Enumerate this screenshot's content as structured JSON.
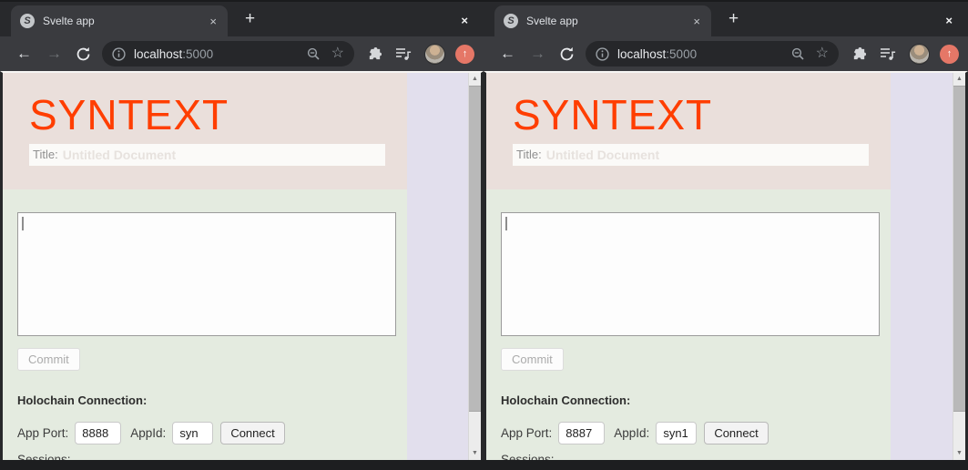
{
  "browser": {
    "tab_title": "Svelte app",
    "url_host": "localhost",
    "url_port": ":5000",
    "favicon_letter": "S"
  },
  "glyphs": {
    "close_x": "×",
    "new_tab_plus": "+",
    "back_arrow": "←",
    "forward_arrow": "→",
    "star": "☆",
    "music_note": "♪",
    "update_arrow": "↑",
    "scroll_up": "▲",
    "scroll_down": "▼"
  },
  "page": {
    "app_title": "SYNTEXT",
    "title_label": "Title:",
    "title_placeholder": "Untitled Document",
    "commit_label": "Commit",
    "connection_heading": "Holochain Connection:",
    "app_port_label": "App Port:",
    "app_id_label": "AppId:",
    "connect_label": "Connect",
    "sessions_label": "Sessions:"
  },
  "windows": [
    {
      "app_port": "8888",
      "app_id": "syn"
    },
    {
      "app_port": "8887",
      "app_id": "syn1"
    }
  ],
  "colors": {
    "svelte_orange": "#ff3e00",
    "header_pink": "#eadfdb",
    "section_green": "#e4ebe0",
    "body_lavender": "#e2dfed",
    "chrome_frame": "#28292c",
    "chrome_toolbar": "#3a3b3f",
    "omnibox": "#26272a",
    "update_badge": "#e57767"
  }
}
